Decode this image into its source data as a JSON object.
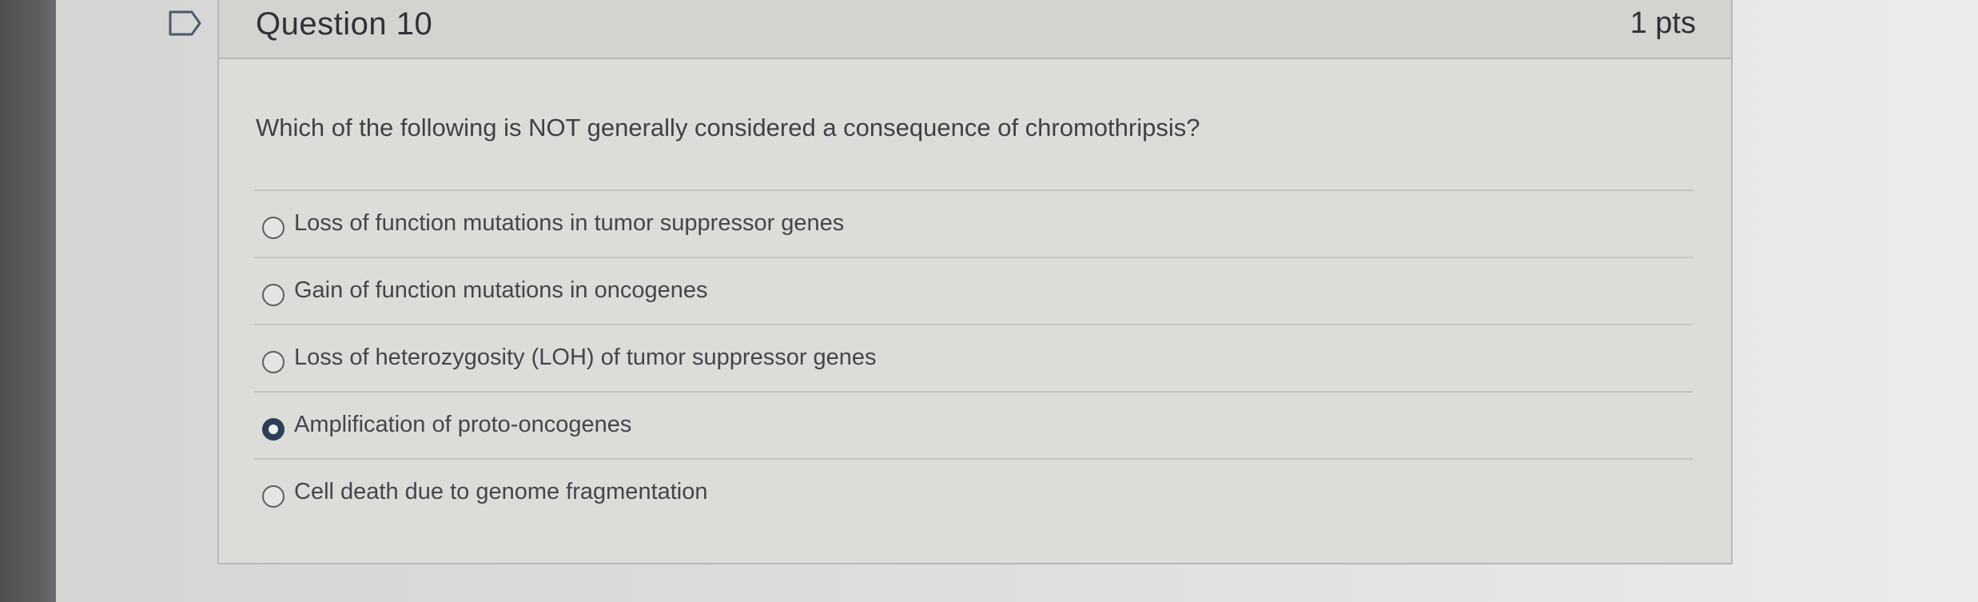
{
  "question": {
    "title": "Question 10",
    "points": "1 pts",
    "text": "Which of the following is NOT generally considered a consequence of chromothripsis?",
    "flag_icon": "flag-outline-icon",
    "selected_index": 3,
    "answers": [
      {
        "label": "Loss of function mutations in tumor suppressor genes",
        "selected": false
      },
      {
        "label": "Gain of function mutations in oncogenes",
        "selected": false
      },
      {
        "label": "Loss of heterozygosity (LOH) of tumor suppressor genes",
        "selected": false
      },
      {
        "label": "Amplification of proto-oncogenes",
        "selected": true
      },
      {
        "label": "Cell death due to genome fragmentation",
        "selected": false
      }
    ]
  },
  "colors": {
    "radio_selected": "#2c3f5a",
    "text": "#2f3236",
    "card_background": "#dcdcd9"
  }
}
